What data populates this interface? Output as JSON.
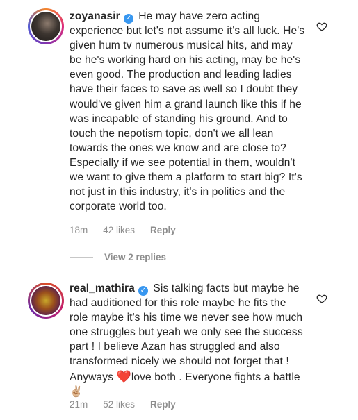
{
  "comments": [
    {
      "username": "zoyanasir",
      "text": "He may have zero acting experience but let's not assume it's all luck. He's given hum tv numerous musical hits, and may be he's working hard on his acting, may be he's even good. The production and leading ladies have their faces to save as well so I doubt they would've given him a grand launch like this if he was incapable of standing his ground. And to touch the nepotism topic, don't we all lean towards the ones we know and are close to? Especially if we see potential in them, wouldn't we want to give them a platform to start big?  It's not just in this industry, it's in politics and the corporate world too.",
      "time": "18m",
      "likes": "42 likes",
      "reply_label": "Reply",
      "view_replies": "View 2 replies"
    },
    {
      "username": "real_mathira",
      "text_before_heart": "Sis talking facts but maybe he had auditioned for this role  maybe he fits the role maybe it's his time we never see how much one struggles but yeah we only see the success part ! I believe Azan has struggled and also transformed nicely we should not forget that ! Anyways ",
      "heart_emoji": "❤️",
      "text_after_heart": "love both . Everyone fights a battle ",
      "hand_emoji": "✌🏼",
      "time": "21m",
      "likes": "52 likes",
      "reply_label": "Reply"
    }
  ],
  "icons": {
    "verified": "verified-badge-icon",
    "like": "heart-outline-icon"
  },
  "colors": {
    "verified_blue": "#3897f0",
    "meta_gray": "#8e8e8e",
    "heart_red": "#e0263c"
  }
}
